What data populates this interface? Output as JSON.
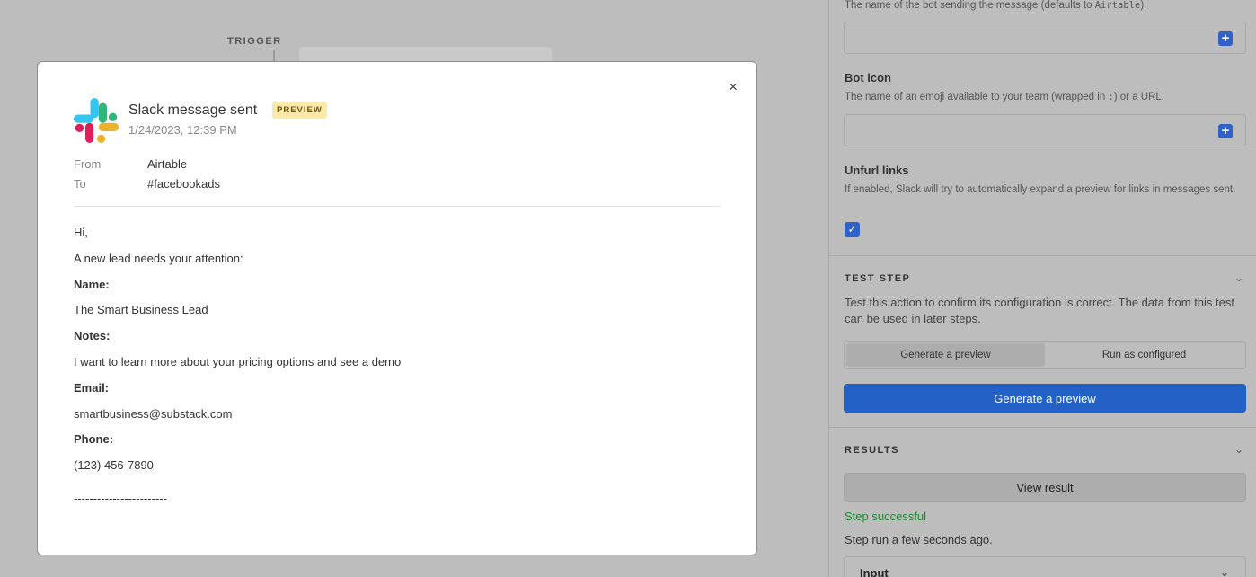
{
  "canvas": {
    "trigger_label": "TRIGGER"
  },
  "panel": {
    "bot_name_help_prefix": "The name of the bot sending the message (defaults to ",
    "bot_name_help_code": "Airtable",
    "bot_name_help_suffix": ").",
    "bot_icon_label": "Bot icon",
    "bot_icon_help_prefix": "The name of an emoji available to your team (wrapped in ",
    "bot_icon_help_code": ":",
    "bot_icon_help_suffix": ") or a URL.",
    "unfurl_label": "Unfurl links",
    "unfurl_help": "If enabled, Slack will try to automatically expand a preview for links in messages sent.",
    "unfurl_checked": true,
    "test_step_title": "TEST STEP",
    "test_step_desc": "Test this action to confirm its configuration is correct. The data from this test can be used in later steps.",
    "seg_generate": "Generate a preview",
    "seg_run": "Run as configured",
    "generate_button": "Generate a preview",
    "results_title": "RESULTS",
    "view_result_button": "View result",
    "status": "Step successful",
    "run_time": "Step run a few seconds ago.",
    "input_section": "Input",
    "accent_color": "#2461c7",
    "success_color": "#1d8a2e"
  },
  "modal": {
    "title": "Slack message sent",
    "badge": "PREVIEW",
    "date": "1/24/2023, 12:39 PM",
    "from_label": "From",
    "from_value": "Airtable",
    "to_label": "To",
    "to_value": "#facebookads",
    "body": [
      {
        "text": "Hi,",
        "bold": false
      },
      {
        "text": "A new lead needs your attention:",
        "bold": false
      },
      {
        "text": "Name:",
        "bold": true
      },
      {
        "text": "The Smart Business Lead",
        "bold": false
      },
      {
        "text": "Notes:",
        "bold": true
      },
      {
        "text": "I want to learn more about your pricing options and see a demo",
        "bold": false
      },
      {
        "text": "Email:",
        "bold": true
      },
      {
        "text": "smartbusiness@substack.com",
        "bold": false
      },
      {
        "text": "Phone:",
        "bold": true
      },
      {
        "text": "(123) 456-7890",
        "bold": false
      },
      {
        "text": "------------------------",
        "bold": false
      }
    ],
    "close_icon": "×"
  }
}
